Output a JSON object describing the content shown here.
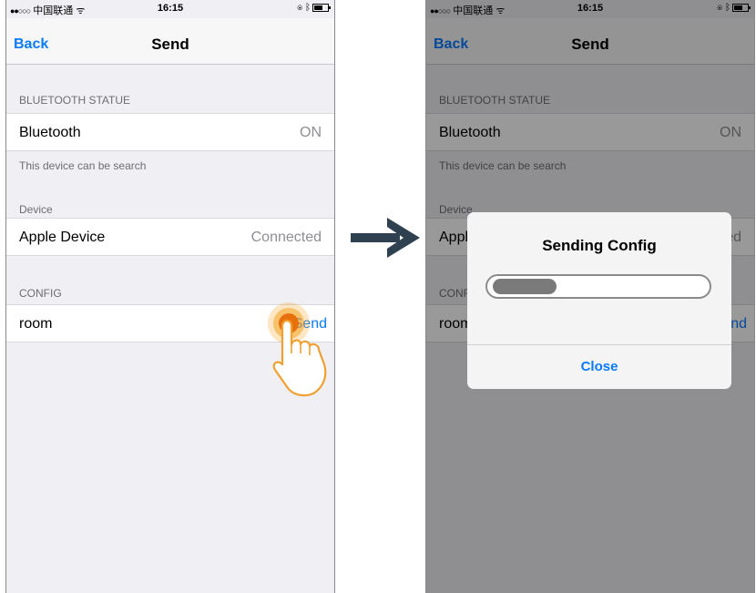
{
  "statusbar": {
    "carrier": "中国联通",
    "time": "16:15"
  },
  "nav": {
    "back": "Back",
    "title": "Send"
  },
  "sections": {
    "bluetooth_header": "BLUETOOTH STATUE",
    "bluetooth_label": "Bluetooth",
    "bluetooth_value": "ON",
    "bluetooth_note": "This device can be search",
    "device_header": "Device",
    "device_label": "Apple Device",
    "device_value": "Connected",
    "config_header": "CONFIG",
    "config_label": "room",
    "config_action": "Send"
  },
  "alert": {
    "title": "Sending Config",
    "close": "Close",
    "progress_fraction": 0.3
  },
  "colors": {
    "accent": "#0a7aff",
    "tap_highlight": "#f39c12",
    "arrow": "#2f4050"
  },
  "icons": [
    "wifi-icon",
    "alarm-icon",
    "bluetooth-icon",
    "battery-icon",
    "arrow-right-icon",
    "tap-hand-icon"
  ]
}
